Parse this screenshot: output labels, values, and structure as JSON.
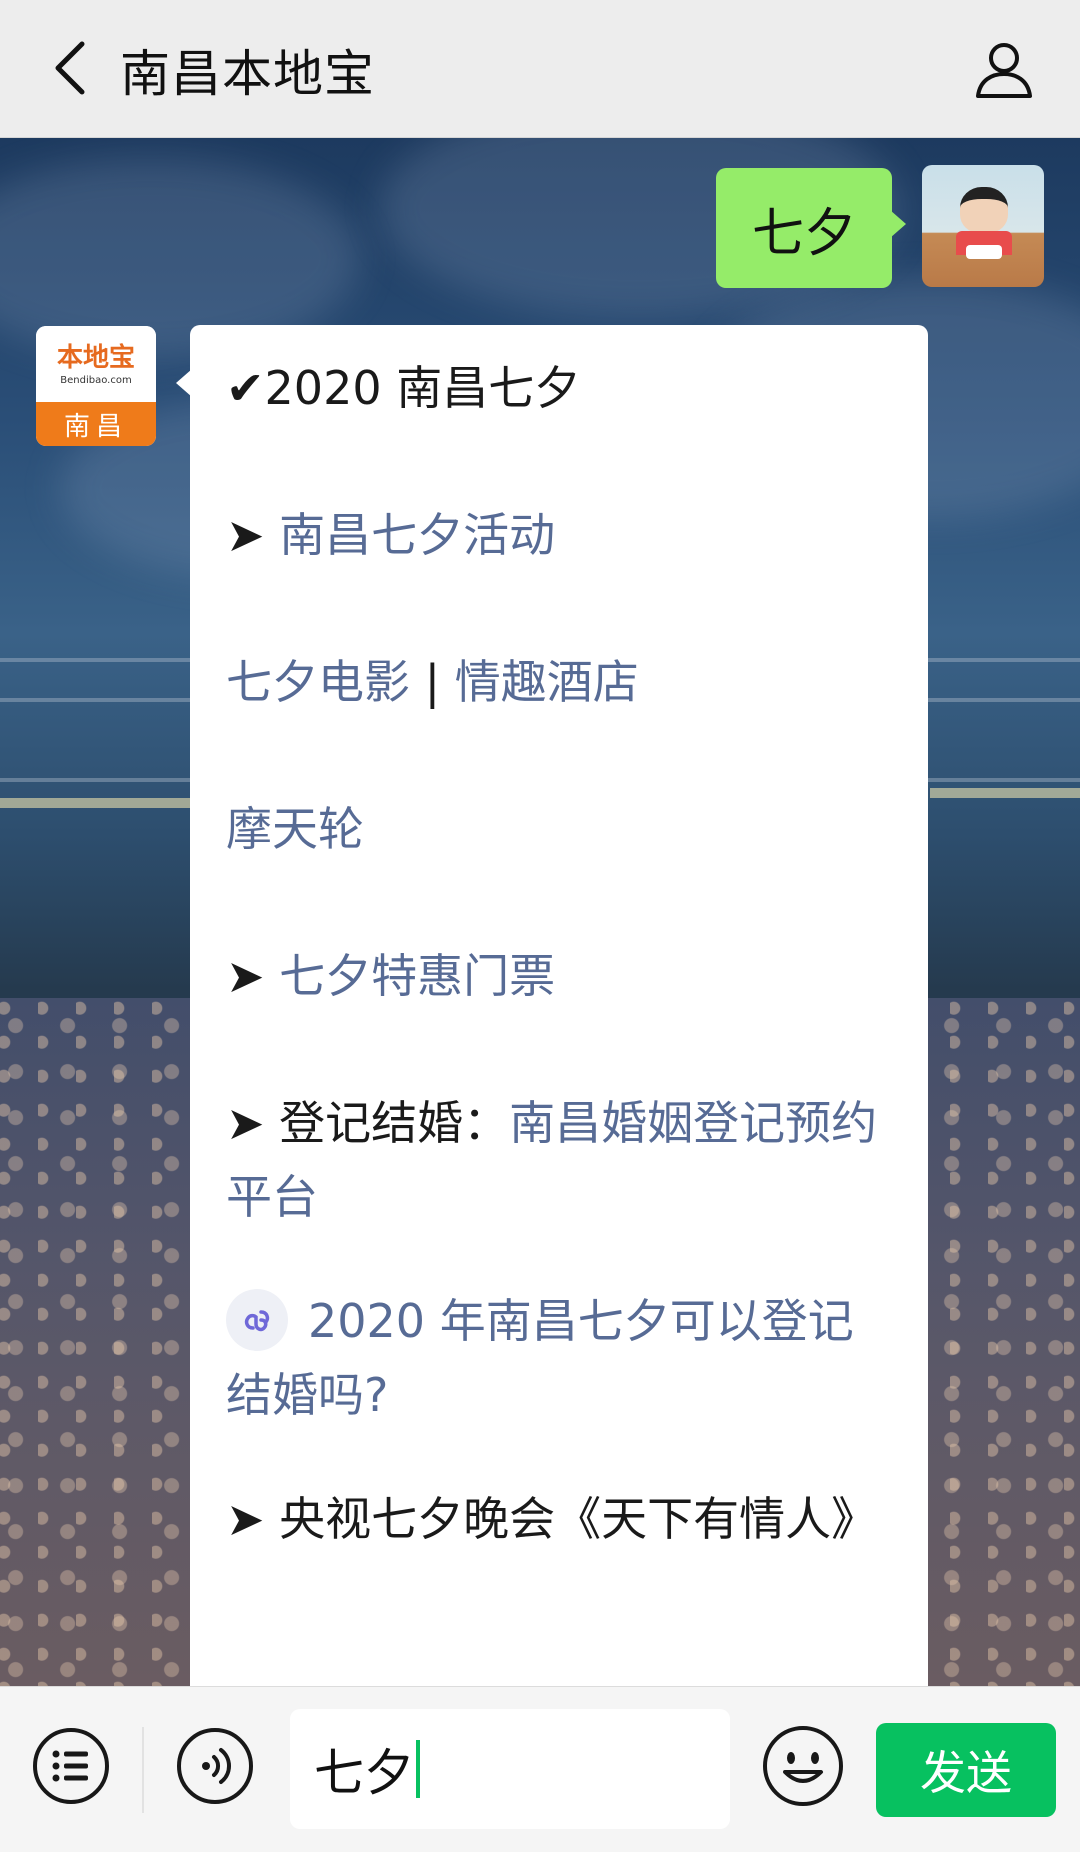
{
  "header": {
    "title": "南昌本地宝"
  },
  "chat": {
    "sent_message": "七夕",
    "bot_avatar": {
      "brand": "本地宝",
      "domain": "Bendibao.com",
      "city": "南昌"
    },
    "reply": {
      "title": "✔2020 南昌七夕",
      "arrow": "➤",
      "item_activities": "南昌七夕活动",
      "item_movies": "七夕电影",
      "separator": " | ",
      "item_hotels": "情趣酒店",
      "item_ferris_wheel": "摩天轮",
      "item_tickets": "七夕特惠门票",
      "marriage_label": "登记结婚：",
      "marriage_link": "南昌婚姻登记预约平台",
      "mini_program_link": "2020 年南昌七夕可以登记结婚吗?",
      "cctv_text": "央视七夕晚会《天下有情人》"
    }
  },
  "input_bar": {
    "input_value": "七夕",
    "send_label": "发送"
  },
  "colors": {
    "header_bg": "#ededed",
    "sent_bubble": "#95ec69",
    "link": "#576b95",
    "send_button": "#07c160"
  }
}
